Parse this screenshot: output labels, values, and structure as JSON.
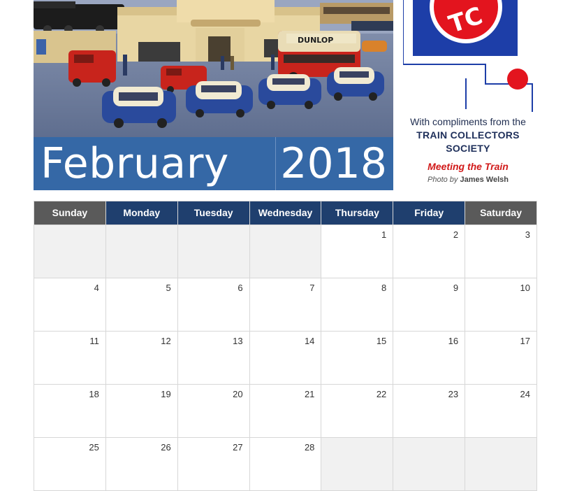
{
  "banner": {
    "month": "February",
    "year": "2018"
  },
  "credits": {
    "compliments": "With compliments from the",
    "society_line1": "TRAIN COLLECTORS",
    "society_line2": "SOCIETY",
    "caption": "Meeting the Train",
    "photo_label": "Photo by",
    "photographer": "James Welsh"
  },
  "photo": {
    "bus_sign": "DUNLOP"
  },
  "logo": {
    "letters": "TC"
  },
  "colors": {
    "banner": "#3568a6",
    "weekday_header": "#1f3f6e",
    "weekend_header": "#5a5a5a",
    "logo_blue": "#1d3ea8",
    "logo_red": "#e3141e",
    "caption_red": "#d11a1a"
  },
  "calendar": {
    "days": [
      "Sunday",
      "Monday",
      "Tuesday",
      "Wednesday",
      "Thursday",
      "Friday",
      "Saturday"
    ],
    "weeks": [
      [
        "",
        "",
        "",
        "",
        "1",
        "2",
        "3"
      ],
      [
        "4",
        "5",
        "6",
        "7",
        "8",
        "9",
        "10"
      ],
      [
        "11",
        "12",
        "13",
        "14",
        "15",
        "16",
        "17"
      ],
      [
        "18",
        "19",
        "20",
        "21",
        "22",
        "23",
        "24"
      ],
      [
        "25",
        "26",
        "27",
        "28",
        "",
        "",
        ""
      ]
    ]
  }
}
